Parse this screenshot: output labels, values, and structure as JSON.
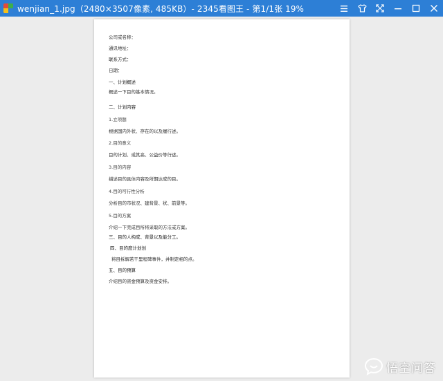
{
  "window": {
    "title": "wenjian_1.jpg（2480×3507像素, 485KB）- 2345看图王 - 第1/1张 19%",
    "controls": {
      "menu_icon": "hamburger-menu-icon",
      "skin_icon": "shirt-skin-icon",
      "fullscreen_icon": "fullscreen-arrows-icon",
      "minimize_icon": "minimize-icon",
      "maximize_icon": "maximize-icon",
      "close_icon": "close-icon"
    },
    "accent_color": "#2d7fd6"
  },
  "document": {
    "lines": [
      "公司或名称：",
      "通讯地址：",
      "联系方式：",
      "日期：",
      "一、计划概述",
      "概述一下目的基本情况。",
      "二、计划内容",
      "1.立项题",
      "根据国内外状、存在的以及履行述。",
      "2.目的意义",
      "目的计划、或其高、公益价等行述。",
      "3.目的内容",
      "描述目的具体内容及所期达成的目。",
      "4.目的可行性分析",
      "分析目的市状况、建背景、状、前景等。",
      "5.目的方案",
      "介绍一下完成目所将采取的方法或方案。",
      "三、目的人构成、背景以及能分工。",
      "四、目的度计划划",
      "将目拆解若干里程碑事件，并制定相的点。",
      "五、目的预算",
      "介绍目的资金预算及资金安排。"
    ]
  },
  "watermark": {
    "text": "悟空问答"
  }
}
